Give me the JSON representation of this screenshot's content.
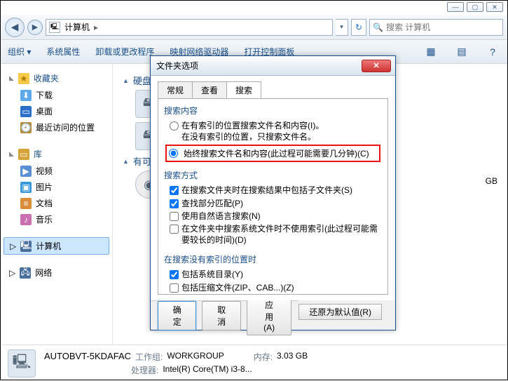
{
  "window": {
    "min": "—",
    "max": "▢",
    "close": "✕"
  },
  "nav": {
    "back": "◀",
    "fwd": "▶",
    "drop": "▾",
    "refresh": "↻",
    "crumb_icon": "🖳",
    "crumb_label": "计算机",
    "crumb_sep": "▸",
    "search_placeholder": "搜索 计算机",
    "search_drop": "▾"
  },
  "toolbar": {
    "organize": "组织 ▾",
    "sysprops": "系统属性",
    "uninstall": "卸载或更改程序",
    "mapdrive": "映射网络驱动器",
    "controlpanel": "打开控制面板",
    "view_icon": "▦",
    "layout_icon": "▤",
    "help_icon": "?"
  },
  "sidebar": {
    "favorites": {
      "label": "收藏夹",
      "tri": "◣",
      "items": [
        {
          "icon": "⬇",
          "label": "下载"
        },
        {
          "icon": "▭",
          "label": "桌面"
        },
        {
          "icon": "🕘",
          "label": "最近访问的位置"
        }
      ]
    },
    "libraries": {
      "label": "库",
      "tri": "◣",
      "items": [
        {
          "icon": "▶",
          "label": "视频"
        },
        {
          "icon": "▣",
          "label": "图片"
        },
        {
          "icon": "≡",
          "label": "文档"
        },
        {
          "icon": "♪",
          "label": "音乐"
        }
      ]
    },
    "computer": {
      "label": "计算机",
      "tri": "▷",
      "icon": "🖳"
    },
    "network": {
      "label": "网络",
      "tri": "▷",
      "icon": "🖧"
    }
  },
  "content": {
    "cat1": {
      "tri": "▲",
      "label": "硬盘 (",
      "dev_icon": "🖴"
    },
    "cat2": {
      "tri": "▲",
      "label": "有可移",
      "dev_icon": "◉"
    },
    "gb_label": "GB"
  },
  "dialog": {
    "title": "文件夹选项",
    "tabs": {
      "general": "常规",
      "view": "查看",
      "search": "搜索"
    },
    "grp1": {
      "title": "搜索内容",
      "opt1_l1": "在有索引的位置搜索文件名和内容(I)。",
      "opt1_l2": "在没有索引的位置，只搜索文件名。",
      "opt2": "始终搜索文件名和内容(此过程可能需要几分钟)(C)"
    },
    "grp2": {
      "title": "搜索方式",
      "c1": "在搜索文件夹时在搜索结果中包括子文件夹(S)",
      "c2": "查找部分匹配(P)",
      "c3": "使用自然语言搜索(N)",
      "c4": "在文件夹中搜索系统文件时不使用索引(此过程可能需要较长的时间)(D)"
    },
    "grp3": {
      "title": "在搜索没有索引的位置时",
      "c1": "包括系统目录(Y)",
      "c2": "包括压缩文件(ZIP、CAB...)(Z)"
    },
    "restore": "还原为默认值(R)",
    "ok": "确定",
    "cancel": "取消",
    "apply": "应用(A)",
    "close_x": "✕"
  },
  "status": {
    "pc_icon": "🖳",
    "hostname": "AUTOBVT-5KDAFAC",
    "workgroup_lbl": "工作组:",
    "workgroup_val": "WORKGROUP",
    "cpu_lbl": "处理器:",
    "cpu_val": "Intel(R) Core(TM) i3-8...",
    "mem_lbl": "内存:",
    "mem_val": "3.03 GB"
  }
}
